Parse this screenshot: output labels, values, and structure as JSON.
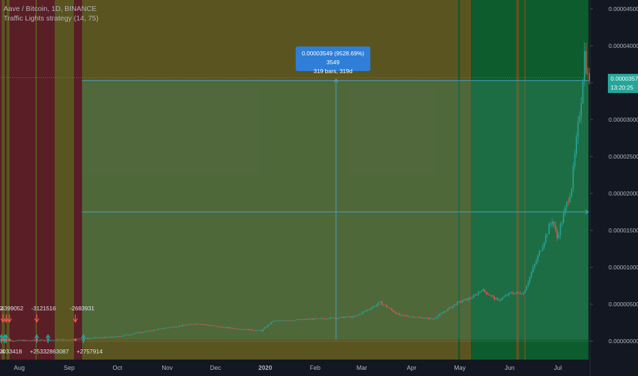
{
  "header": {
    "symbol_line": "Aave / Bitcoin, 1D, BINANCE",
    "strategy_line": "Traffic Lights strategy (14, 75)"
  },
  "measure": {
    "line1": "0.00003549 (9528.69%) 3549",
    "line2": "319 bars, 319d"
  },
  "price_badge": {
    "price": "0.00003570",
    "countdown": "13:20:25"
  },
  "colors": {
    "background": "#131722",
    "red_zone": "#5a1e26",
    "yellow_zone": "#5a5520",
    "green_zone": "#0d5c2e",
    "up_candle": "#26a69a",
    "down_candle": "#ef5350",
    "measure": "#2f7ed8",
    "axis_text": "#b2b5be"
  },
  "chart_data": {
    "type": "candlestick",
    "y_axis_labels": [
      "0.00004500",
      "0.00004000",
      "0.00003500",
      "0.00003000",
      "0.00002500",
      "0.00002000",
      "0.00001500",
      "0.00001000",
      "0.00000500",
      "0.00000000"
    ],
    "ylim": [
      -2.5e-06,
      4.62e-05
    ],
    "x_axis_labels": [
      "Aug",
      "Sep",
      "Oct",
      "Nov",
      "Dec",
      "2020",
      "Feb",
      "Mar",
      "Apr",
      "May",
      "Jun",
      "Jul"
    ],
    "x_label_dates": [
      "2019-08-01",
      "2019-09-01",
      "2019-10-01",
      "2019-11-01",
      "2019-12-01",
      "2020-01-01",
      "2020-02-01",
      "2020-03-01",
      "2020-04-01",
      "2020-05-01",
      "2020-06-01",
      "2020-07-01"
    ],
    "background_zones": [
      {
        "from": "2019-07-20",
        "to": "2019-07-21",
        "state": "red"
      },
      {
        "from": "2019-07-21",
        "to": "2019-07-23",
        "state": "yellow"
      },
      {
        "from": "2019-07-23",
        "to": "2019-07-24",
        "state": "red"
      },
      {
        "from": "2019-07-24",
        "to": "2019-07-26",
        "state": "yellow"
      },
      {
        "from": "2019-07-26",
        "to": "2019-08-11",
        "state": "red"
      },
      {
        "from": "2019-08-11",
        "to": "2019-08-12",
        "state": "yellow"
      },
      {
        "from": "2019-08-12",
        "to": "2019-08-23",
        "state": "red"
      },
      {
        "from": "2019-08-23",
        "to": "2019-09-04",
        "state": "yellow"
      },
      {
        "from": "2019-09-04",
        "to": "2019-09-09",
        "state": "red"
      },
      {
        "from": "2019-09-09",
        "to": "2020-04-30",
        "state": "yellow"
      },
      {
        "from": "2020-04-30",
        "to": "2020-05-01",
        "state": "green"
      },
      {
        "from": "2020-05-01",
        "to": "2020-05-08",
        "state": "yellow"
      },
      {
        "from": "2020-05-08",
        "to": "2020-06-05",
        "state": "green"
      },
      {
        "from": "2020-06-05",
        "to": "2020-06-07",
        "state": "yellow"
      },
      {
        "from": "2020-06-07",
        "to": "2020-06-10",
        "state": "green"
      },
      {
        "from": "2020-06-10",
        "to": "2020-06-11",
        "state": "yellow"
      },
      {
        "from": "2020-06-11",
        "to": "2020-07-20",
        "state": "green"
      }
    ],
    "price_path": [
      [
        "2019-07-20",
        5e-08
      ],
      [
        "2019-09-01",
        2e-07
      ],
      [
        "2019-10-01",
        6e-07
      ],
      [
        "2019-11-01",
        1.8e-06
      ],
      [
        "2019-11-20",
        2.4e-06
      ],
      [
        "2019-12-05",
        1.9e-06
      ],
      [
        "2019-12-30",
        1.4e-06
      ],
      [
        "2020-01-06",
        2.7e-06
      ],
      [
        "2020-02-01",
        3e-06
      ],
      [
        "2020-02-26",
        3.3e-06
      ],
      [
        "2020-03-13",
        5.2e-06
      ],
      [
        "2020-03-25",
        3.5e-06
      ],
      [
        "2020-04-15",
        3e-06
      ],
      [
        "2020-04-30",
        5.2e-06
      ],
      [
        "2020-05-10",
        6e-06
      ],
      [
        "2020-05-15",
        7e-06
      ],
      [
        "2020-05-25",
        5.5e-06
      ],
      [
        "2020-06-02",
        6.5e-06
      ],
      [
        "2020-06-10",
        6.5e-06
      ],
      [
        "2020-06-20",
        1.2e-05
      ],
      [
        "2020-06-28",
        1.65e-05
      ],
      [
        "2020-07-01",
        1.4e-05
      ],
      [
        "2020-07-05",
        1.7e-05
      ],
      [
        "2020-07-10",
        2.1e-05
      ],
      [
        "2020-07-13",
        2.7e-05
      ],
      [
        "2020-07-16",
        3.3e-05
      ],
      [
        "2020-07-18",
        3.9e-05
      ],
      [
        "2020-07-20",
        3.57e-05
      ]
    ],
    "measurement": {
      "from_date": "2019-09-09",
      "to_date": "2020-07-20",
      "lower_price": 1.75e-05,
      "upper_price": 3.53e-05,
      "vertical_date": "2020-02-14",
      "vertical_from": 2e-07,
      "vertical_to": 3.55e-05
    },
    "current_price": 3.57e-05,
    "signals": [
      {
        "date": "2019-07-20",
        "kind": "entry",
        "label": "+14"
      },
      {
        "date": "2019-07-22",
        "kind": "entry",
        "label": ""
      },
      {
        "date": "2019-07-23",
        "kind": "entry",
        "label": "2033418"
      },
      {
        "date": "2019-07-21",
        "kind": "exit",
        "label": "-2"
      },
      {
        "date": "2019-07-23",
        "kind": "exit",
        "label": "4399052"
      },
      {
        "date": "2019-07-25",
        "kind": "exit",
        "label": ""
      },
      {
        "date": "2019-08-11",
        "kind": "entry",
        "label": "+25332863087"
      },
      {
        "date": "2019-08-11",
        "kind": "exit",
        "label": "-3121516"
      },
      {
        "date": "2019-08-18",
        "kind": "entry",
        "label": ""
      },
      {
        "date": "2019-09-04",
        "kind": "exit",
        "label": "-2683931"
      },
      {
        "date": "2019-09-09",
        "kind": "entry",
        "label": "+2757914"
      }
    ]
  }
}
